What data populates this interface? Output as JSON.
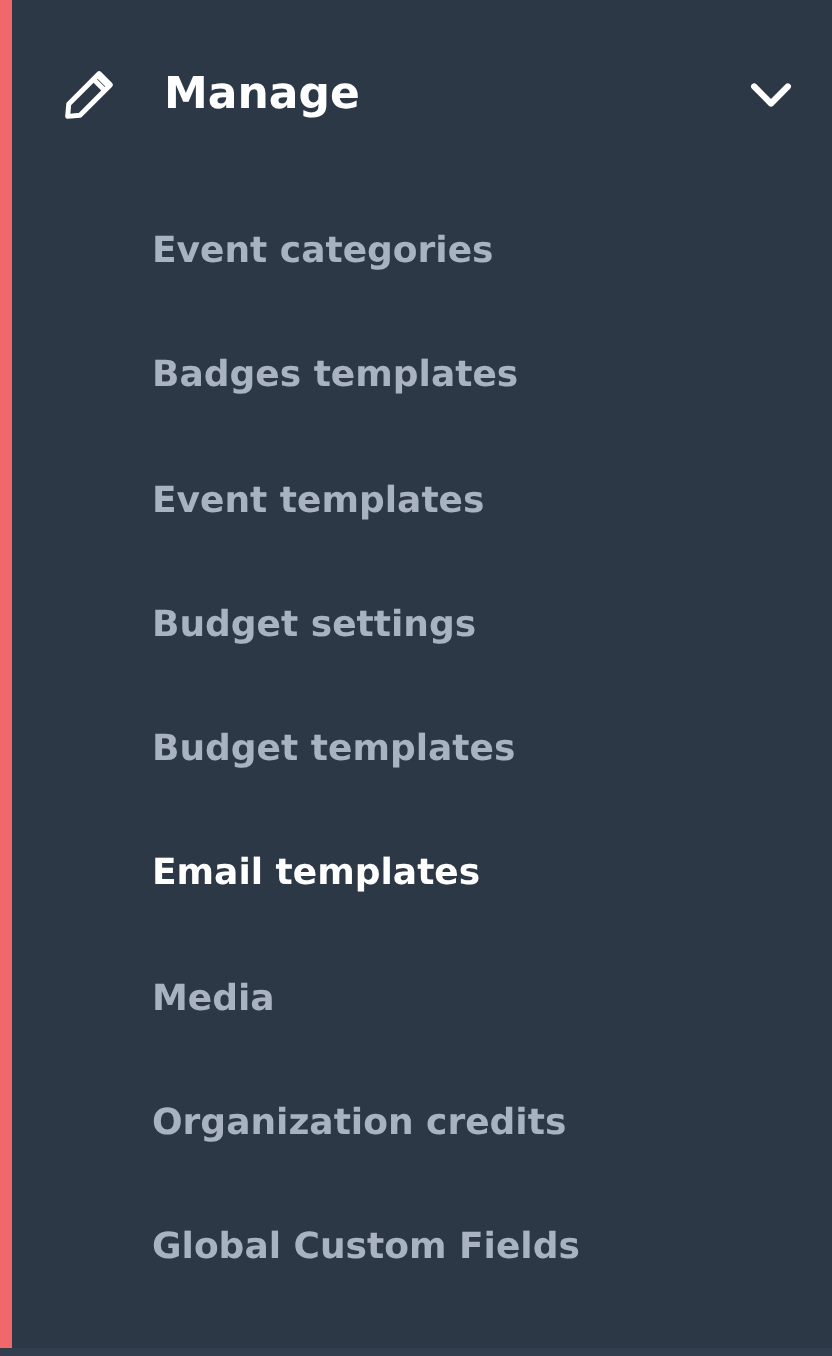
{
  "section": {
    "title": "Manage",
    "expanded": true,
    "items": [
      {
        "label": "Event categories",
        "selected": false
      },
      {
        "label": "Badges templates",
        "selected": false
      },
      {
        "label": "Event templates",
        "selected": false
      },
      {
        "label": "Budget settings",
        "selected": false
      },
      {
        "label": "Budget templates",
        "selected": false
      },
      {
        "label": "Email templates",
        "selected": true
      },
      {
        "label": "Media",
        "selected": false
      },
      {
        "label": "Organization credits",
        "selected": false
      },
      {
        "label": "Global Custom Fields",
        "selected": false
      }
    ]
  }
}
